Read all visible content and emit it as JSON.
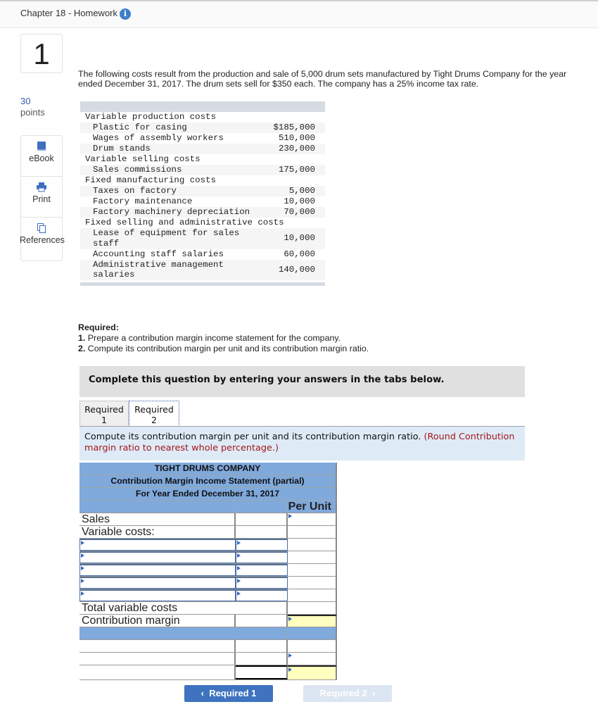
{
  "header": {
    "title": "Chapter 18 - Homework",
    "info_icon": "info-icon"
  },
  "question": {
    "number": "1",
    "points_value": "30",
    "points_label": "points"
  },
  "tools": [
    {
      "label": "eBook",
      "icon": "book-icon"
    },
    {
      "label": "Print",
      "icon": "printer-icon"
    },
    {
      "label": "References",
      "icon": "copy-icon"
    }
  ],
  "intro": "The following costs result from the production and sale of 5,000 drum sets manufactured by Tight Drums Company for the year ended December 31, 2017. The drum sets sell for $350 each. The company has a 25% income tax rate.",
  "costs": [
    {
      "label": "Variable production costs",
      "value": "",
      "indent": false
    },
    {
      "label": "Plastic for casing",
      "value": "$185,000",
      "indent": true
    },
    {
      "label": "Wages of assembly workers",
      "value": "510,000",
      "indent": true
    },
    {
      "label": "Drum stands",
      "value": "230,000",
      "indent": true
    },
    {
      "label": "Variable selling costs",
      "value": "",
      "indent": false
    },
    {
      "label": "Sales commissions",
      "value": "175,000",
      "indent": true
    },
    {
      "label": "Fixed manufacturing costs",
      "value": "",
      "indent": false
    },
    {
      "label": "Taxes on factory",
      "value": "5,000",
      "indent": true
    },
    {
      "label": "Factory maintenance",
      "value": "10,000",
      "indent": true
    },
    {
      "label": "Factory machinery depreciation",
      "value": "70,000",
      "indent": true
    },
    {
      "label": "Fixed selling and administrative costs",
      "value": "",
      "indent": false
    },
    {
      "label": "Lease of equipment for sales staff",
      "value": "10,000",
      "indent": true
    },
    {
      "label": "Accounting staff salaries",
      "value": "60,000",
      "indent": true
    },
    {
      "label": "Administrative management salaries",
      "value": "140,000",
      "indent": true
    }
  ],
  "required": {
    "heading": "Required:",
    "items": [
      {
        "num": "1.",
        "text": "Prepare a contribution margin income statement for the company."
      },
      {
        "num": "2.",
        "text": "Compute its contribution margin per unit and its contribution margin ratio."
      }
    ]
  },
  "complete_banner": "Complete this question by entering your answers in the tabs below.",
  "tabs": [
    {
      "line1": "Required",
      "line2": "1",
      "active": false
    },
    {
      "line1": "Required",
      "line2": "2",
      "active": true
    }
  ],
  "instruction": {
    "text": "Compute its contribution margin per unit and its contribution margin ratio.",
    "note": "(Round Contribution margin ratio to nearest whole percentage.)"
  },
  "statement": {
    "company": "TIGHT DRUMS COMPANY",
    "title": "Contribution Margin Income Statement (partial)",
    "period": "For Year Ended December 31, 2017",
    "col_per_unit": "Per Unit",
    "rows": {
      "sales": "Sales",
      "variable_costs": "Variable costs:",
      "total_variable": "Total variable costs",
      "contribution_margin": "Contribution margin"
    }
  },
  "nav": {
    "prev": "Required 1",
    "next": "Required 2"
  },
  "colors": {
    "accent": "#3f73bf",
    "table_header": "#80a9dc",
    "highlight": "#ffffbf",
    "note_red": "#a4161a"
  }
}
